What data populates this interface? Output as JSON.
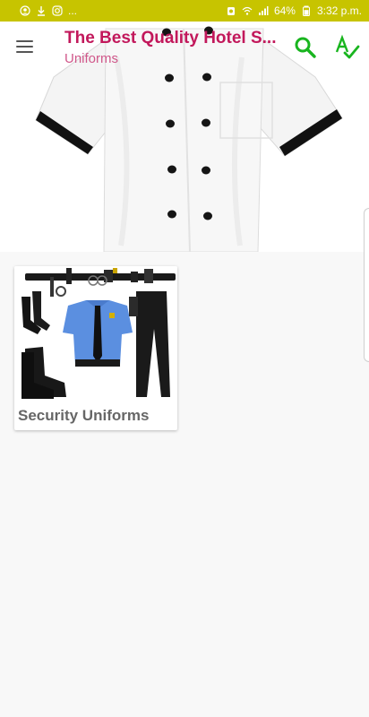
{
  "status_bar": {
    "left_icons": [
      "person-circle-icon",
      "download-icon",
      "instagram-icon"
    ],
    "left_more": "...",
    "battery": "64%",
    "time": "3:32 p.m."
  },
  "toolbar": {
    "title": "The Best Quality Hotel S...",
    "subtitle": "Uniforms",
    "menu_icon": "menu-icon",
    "search_icon": "search-icon",
    "spellcheck_icon": "spellcheck-icon"
  },
  "hero": {
    "image": "white-chef-jacket-image"
  },
  "categories": [
    {
      "title": "Security Uniforms",
      "image": "security-uniform-set-image"
    }
  ],
  "colors": {
    "status_bar": "#c7c400",
    "title": "#c2185b",
    "subtitle": "#d0578a",
    "action_icons": "#19b51f",
    "background": "#f8f8f8"
  }
}
